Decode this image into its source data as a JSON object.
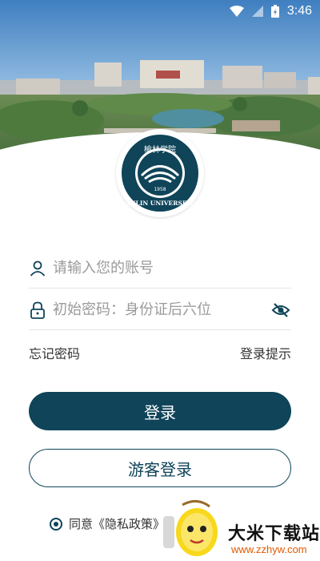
{
  "status_bar": {
    "time": "3:46"
  },
  "logo": {
    "top_text": "榆林学院",
    "bottom_text": "YULIN UNIVERSITY",
    "year": "1958"
  },
  "login": {
    "account_placeholder": "请输入您的账号",
    "password_placeholder": "初始密码：身份证后六位",
    "forgot_password": "忘记密码",
    "login_hint": "登录提示",
    "login_button": "登录",
    "guest_login_button": "游客登录",
    "agree_prefix": "同意",
    "privacy_link": "《隐私政策》"
  },
  "watermark": {
    "site_name": "大米下载站",
    "url": "www.zzhyw.com"
  },
  "colors": {
    "primary": "#0f4459",
    "watermark_url": "#e35a00"
  }
}
